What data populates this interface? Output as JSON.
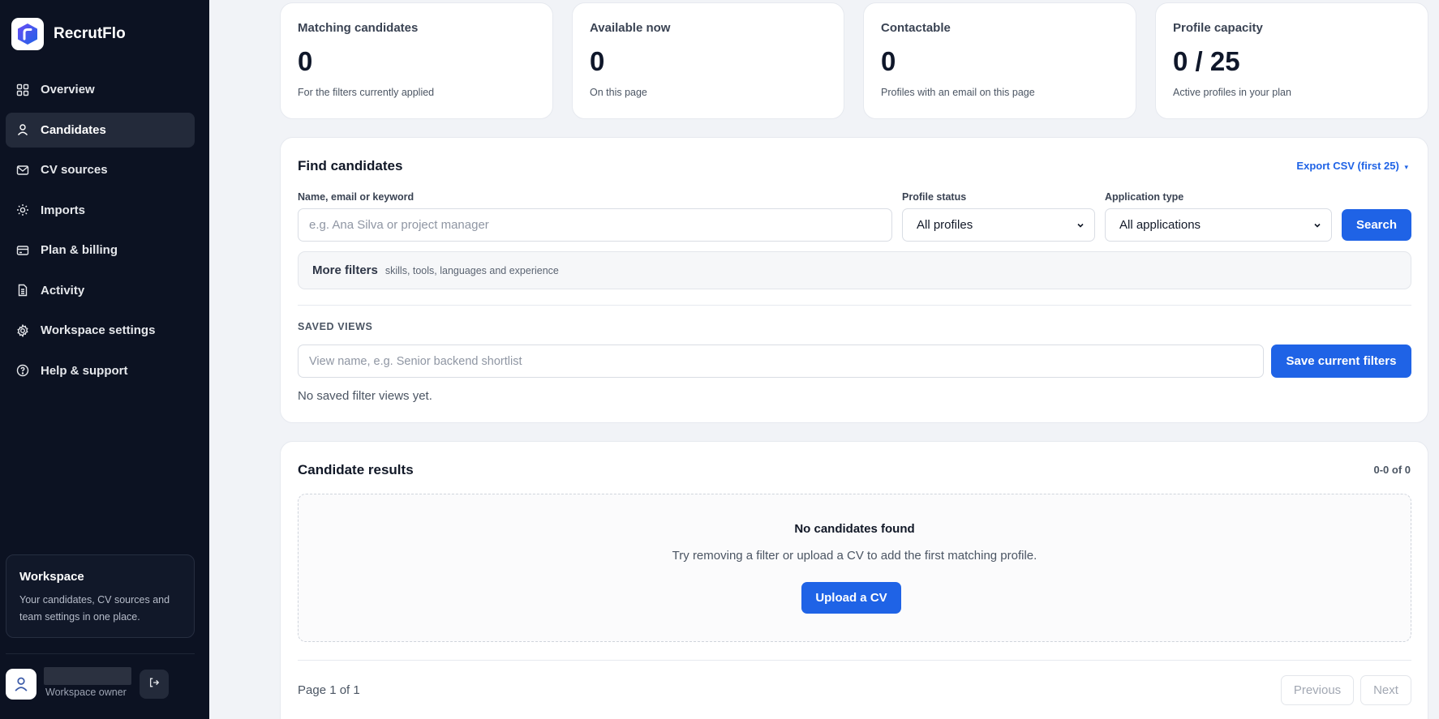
{
  "app": {
    "name": "RecrutFlo"
  },
  "sidebar": {
    "items": [
      {
        "label": "Overview",
        "icon": "grid-icon"
      },
      {
        "label": "Candidates",
        "icon": "user-icon",
        "active": true
      },
      {
        "label": "CV sources",
        "icon": "mail-icon"
      },
      {
        "label": "Imports",
        "icon": "sun-icon"
      },
      {
        "label": "Plan & billing",
        "icon": "credit-card-icon"
      },
      {
        "label": "Activity",
        "icon": "document-icon"
      },
      {
        "label": "Workspace settings",
        "icon": "gear-icon"
      },
      {
        "label": "Help & support",
        "icon": "help-icon"
      }
    ],
    "workspace_card": {
      "title": "Workspace",
      "description": "Your candidates, CV sources and team settings in one place."
    },
    "user": {
      "role": "Workspace owner"
    }
  },
  "stats": [
    {
      "label": "Matching candidates",
      "value": "0",
      "sub": "For the filters currently applied"
    },
    {
      "label": "Available now",
      "value": "0",
      "sub": "On this page"
    },
    {
      "label": "Contactable",
      "value": "0",
      "sub": "Profiles with an email on this page"
    },
    {
      "label": "Profile capacity",
      "value": "0 / 25",
      "sub": "Active profiles in your plan"
    }
  ],
  "find": {
    "title": "Find candidates",
    "export_label": "Export CSV (first 25)",
    "keyword_label": "Name, email or keyword",
    "keyword_placeholder": "e.g. Ana Silva or project manager",
    "status_label": "Profile status",
    "status_value": "All profiles",
    "app_type_label": "Application type",
    "app_type_value": "All applications",
    "search_button": "Search",
    "more_filters_title": "More filters",
    "more_filters_sub": "skills, tools, languages and experience",
    "saved_views_label": "SAVED VIEWS",
    "view_name_placeholder": "View name, e.g. Senior backend shortlist",
    "save_button": "Save current filters",
    "no_views_text": "No saved filter views yet."
  },
  "results": {
    "title": "Candidate results",
    "count": "0-0 of 0",
    "empty_title": "No candidates found",
    "empty_desc": "Try removing a filter or upload a CV to add the first matching profile.",
    "upload_button": "Upload a CV",
    "page_info": "Page 1 of 1",
    "prev_button": "Previous",
    "next_button": "Next"
  },
  "colors": {
    "sidebar_bg": "#0c1222",
    "primary": "#1f63e6",
    "page_bg": "#f1f3f7"
  }
}
